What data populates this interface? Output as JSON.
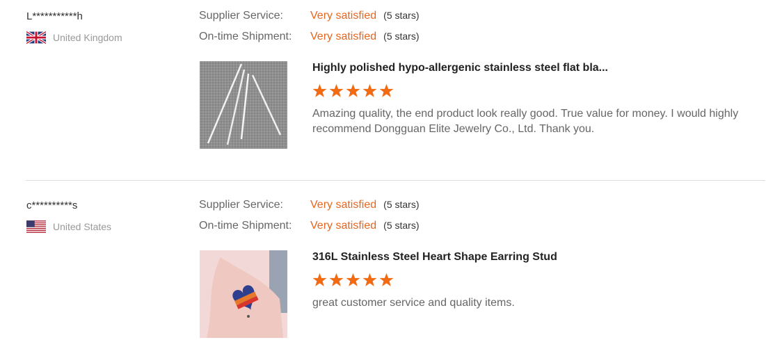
{
  "reviews": [
    {
      "buyer": "L***********h",
      "country": "United Kingdom",
      "flag_icon": "uk-flag-icon",
      "supplier_service_label": "Supplier Service:",
      "supplier_service_value": "Very satisfied",
      "supplier_service_stars": "(5 stars)",
      "shipment_label": "On-time Shipment:",
      "shipment_value": "Very satisfied",
      "shipment_stars": "(5 stars)",
      "product_title": "Highly polished hypo-allergenic stainless steel flat bla...",
      "product_rating": 5,
      "comment": "Amazing quality, the end product look really good. True value for money. I would highly recommend Dongguan Elite Jewelry Co., Ltd. Thank you."
    },
    {
      "buyer": "c**********s",
      "country": "United States",
      "flag_icon": "us-flag-icon",
      "supplier_service_label": "Supplier Service:",
      "supplier_service_value": "Very satisfied",
      "supplier_service_stars": "(5 stars)",
      "shipment_label": "On-time Shipment:",
      "shipment_value": "Very satisfied",
      "shipment_stars": "(5 stars)",
      "product_title": "316L Stainless Steel Heart Shape Earring Stud",
      "product_rating": 5,
      "comment": "great customer service and quality items."
    }
  ],
  "colors": {
    "accent": "#e8651c",
    "star": "#f26a13",
    "divider": "#dddddd"
  }
}
